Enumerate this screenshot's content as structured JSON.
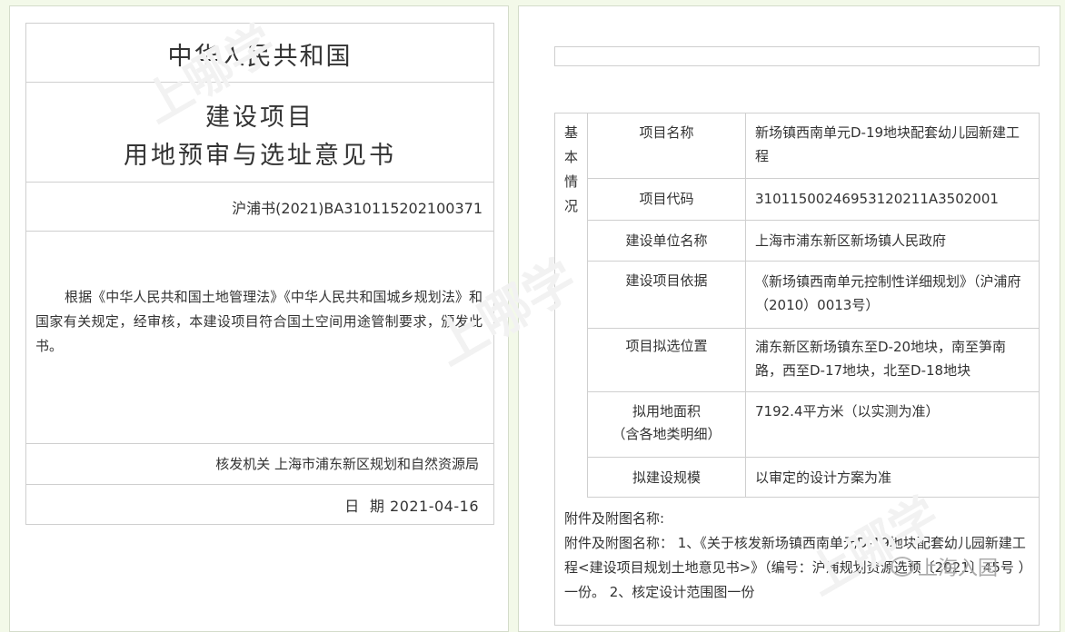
{
  "certificate": {
    "country": "中华人民共和国",
    "title_line1": "建设项目",
    "title_line2": "用地预审与选址意见书",
    "doc_number": "沪浦书(2021)BA310115202100371",
    "body": "根据《中华人民共和国土地管理法》《中华人民共和国城乡规划法》和国家有关规定，经审核，本建设项目符合国土空间用途管制要求，颁发此书。",
    "issuer": "核发机关 上海市浦东新区规划和自然资源局",
    "date": "日  期 2021-04-16"
  },
  "details": {
    "category": "基本情况",
    "rows": [
      {
        "label": "项目名称",
        "value": "新场镇西南单元D-19地块配套幼儿园新建工程"
      },
      {
        "label": "项目代码",
        "value": "31011500246953120211A3502001"
      },
      {
        "label": "建设单位名称",
        "value": "上海市浦东新区新场镇人民政府"
      },
      {
        "label": "建设项目依据",
        "value": "《新场镇西南单元控制性详细规划》（沪浦府（2010）0013号）"
      },
      {
        "label": "项目拟选位置",
        "value": "浦东新区新场镇东至D-20地块，南至笋南路，西至D-17地块，北至D-18地块"
      },
      {
        "label": "拟用地面积\n（含各地类明细）",
        "value": "7192.4平方米（以实测为准）"
      },
      {
        "label": "拟建设规模",
        "value": "以审定的设计方案为准"
      }
    ],
    "attachments_heading": "附件及附图名称:",
    "attachments_text": "附件及附图名称： 1、《关于核发新场镇西南单元D-19地块配套幼儿园新建工程<建设项目规划土地意见书>》（编号：沪浦规划资源选预〔2021〕45号 ）一份。 2、核定设计范围图一份"
  },
  "watermarks": {
    "text1": "上哪学",
    "text2": "上哪学",
    "text3": "上哪学",
    "account": "上海入园"
  }
}
